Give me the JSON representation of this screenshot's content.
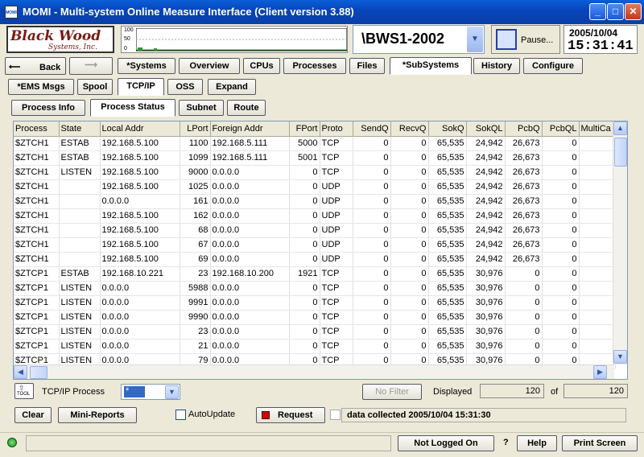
{
  "window": {
    "title": "MOMI - Multi-system Online Measure Interface (Client version 3.88)",
    "icon_text": "MOMI"
  },
  "logo": {
    "line1": "Black Wood",
    "line2": "Systems, Inc."
  },
  "graph": {
    "axis_top": "100",
    "axis_mid": "50",
    "axis_bottom": "0"
  },
  "system": {
    "name": "\\BWS1-2002"
  },
  "pause": {
    "label": "Pause..."
  },
  "datetime": {
    "date": "2005/10/04",
    "time": "15:31:41"
  },
  "nav": {
    "back": "Back",
    "tabs": [
      "*Systems",
      "Overview",
      "CPUs",
      "Processes",
      "Files",
      "*SubSystems",
      "History",
      "Configure"
    ],
    "active_tab": "*SubSystems"
  },
  "subtabs": [
    "*EMS Msgs",
    "Spool",
    "TCP/IP",
    "OSS",
    "Expand"
  ],
  "active_subtab": "TCP/IP",
  "tcptabs": [
    "Process Info",
    "Process Status",
    "Subnet",
    "Route"
  ],
  "active_tcptab": "Process Status",
  "table": {
    "columns": [
      "Process",
      "State",
      "Local Addr",
      "LPort",
      "Foreign Addr",
      "FPort",
      "Proto",
      "SendQ",
      "RecvQ",
      "SokQ",
      "SokQL",
      "PcbQ",
      "PcbQL",
      "MultiCa"
    ],
    "rows": [
      [
        "$ZTCH1",
        "ESTAB",
        "192.168.5.100",
        "1100",
        "192.168.5.111",
        "5000",
        "TCP",
        "0",
        "0",
        "65,535",
        "24,942",
        "26,673",
        "0",
        ""
      ],
      [
        "$ZTCH1",
        "ESTAB",
        "192.168.5.100",
        "1099",
        "192.168.5.111",
        "5001",
        "TCP",
        "0",
        "0",
        "65,535",
        "24,942",
        "26,673",
        "0",
        ""
      ],
      [
        "$ZTCH1",
        "LISTEN",
        "192.168.5.100",
        "9000",
        "0.0.0.0",
        "0",
        "TCP",
        "0",
        "0",
        "65,535",
        "24,942",
        "26,673",
        "0",
        ""
      ],
      [
        "$ZTCH1",
        "",
        "192.168.5.100",
        "1025",
        "0.0.0.0",
        "0",
        "UDP",
        "0",
        "0",
        "65,535",
        "24,942",
        "26,673",
        "0",
        ""
      ],
      [
        "$ZTCH1",
        "",
        "0.0.0.0",
        "161",
        "0.0.0.0",
        "0",
        "UDP",
        "0",
        "0",
        "65,535",
        "24,942",
        "26,673",
        "0",
        ""
      ],
      [
        "$ZTCH1",
        "",
        "192.168.5.100",
        "162",
        "0.0.0.0",
        "0",
        "UDP",
        "0",
        "0",
        "65,535",
        "24,942",
        "26,673",
        "0",
        ""
      ],
      [
        "$ZTCH1",
        "",
        "192.168.5.100",
        "68",
        "0.0.0.0",
        "0",
        "UDP",
        "0",
        "0",
        "65,535",
        "24,942",
        "26,673",
        "0",
        ""
      ],
      [
        "$ZTCH1",
        "",
        "192.168.5.100",
        "67",
        "0.0.0.0",
        "0",
        "UDP",
        "0",
        "0",
        "65,535",
        "24,942",
        "26,673",
        "0",
        ""
      ],
      [
        "$ZTCH1",
        "",
        "192.168.5.100",
        "69",
        "0.0.0.0",
        "0",
        "UDP",
        "0",
        "0",
        "65,535",
        "24,942",
        "26,673",
        "0",
        ""
      ],
      [
        "$ZTCP1",
        "ESTAB",
        "192.168.10.221",
        "23",
        "192.168.10.200",
        "1921",
        "TCP",
        "0",
        "0",
        "65,535",
        "30,976",
        "0",
        "0",
        ""
      ],
      [
        "$ZTCP1",
        "LISTEN",
        "0.0.0.0",
        "5988",
        "0.0.0.0",
        "0",
        "TCP",
        "0",
        "0",
        "65,535",
        "30,976",
        "0",
        "0",
        ""
      ],
      [
        "$ZTCP1",
        "LISTEN",
        "0.0.0.0",
        "9991",
        "0.0.0.0",
        "0",
        "TCP",
        "0",
        "0",
        "65,535",
        "30,976",
        "0",
        "0",
        ""
      ],
      [
        "$ZTCP1",
        "LISTEN",
        "0.0.0.0",
        "9990",
        "0.0.0.0",
        "0",
        "TCP",
        "0",
        "0",
        "65,535",
        "30,976",
        "0",
        "0",
        ""
      ],
      [
        "$ZTCP1",
        "LISTEN",
        "0.0.0.0",
        "23",
        "0.0.0.0",
        "0",
        "TCP",
        "0",
        "0",
        "65,535",
        "30,976",
        "0",
        "0",
        ""
      ],
      [
        "$ZTCP1",
        "LISTEN",
        "0.0.0.0",
        "21",
        "0.0.0.0",
        "0",
        "TCP",
        "0",
        "0",
        "65,535",
        "30,976",
        "0",
        "0",
        ""
      ],
      [
        "$ZTCP1",
        "LISTEN",
        "0.0.0.0",
        "79",
        "0.0.0.0",
        "0",
        "TCP",
        "0",
        "0",
        "65,535",
        "30,976",
        "0",
        "0",
        ""
      ]
    ]
  },
  "filter": {
    "tool_label": "TOOL",
    "process_label": "TCP/IP Process",
    "process_value": "*",
    "no_filter": "No Filter",
    "displayed_label": "Displayed",
    "displayed": "120",
    "of_label": "of",
    "total": "120"
  },
  "actions": {
    "clear": "Clear",
    "mini_reports": "Mini-Reports",
    "autoupdate": "AutoUpdate",
    "request": "Request",
    "collected": "data collected 2005/10/04 15:31:30"
  },
  "footer": {
    "not_logged_on": "Not Logged On",
    "question": "?",
    "help": "Help",
    "print": "Print Screen"
  }
}
